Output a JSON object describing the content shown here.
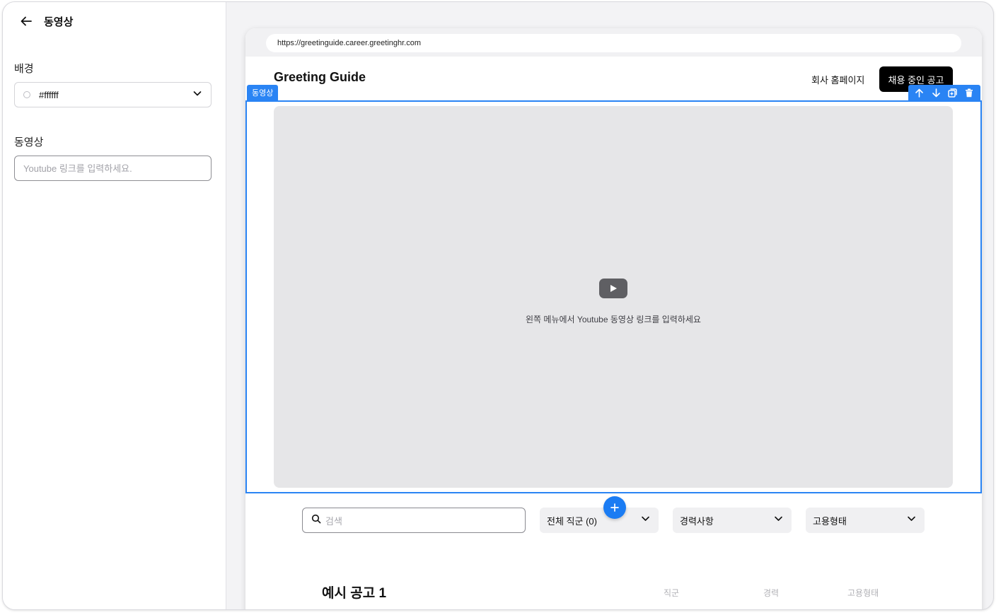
{
  "sidebar": {
    "title": "동영상",
    "background_label": "배경",
    "background_value": "#ffffff",
    "video_label": "동영상",
    "video_input_placeholder": "Youtube 링크를 입력하세요.",
    "video_input_value": ""
  },
  "browser": {
    "url": "https://greetinguide.career.greetinghr.com"
  },
  "site": {
    "logo": "Greeting Guide",
    "nav_home": "회사 홈페이지",
    "nav_jobs": "채용 중인 공고"
  },
  "video_block": {
    "tag": "동영상",
    "hint": "왼쪽 메뉴에서 Youtube 동영상 링크를 입력하세요",
    "toolbar": [
      "arrow-up-icon",
      "arrow-down-icon",
      "duplicate-icon",
      "trash-icon"
    ]
  },
  "filters": {
    "search_placeholder": "검색",
    "job_group": "전체 직군 (0)",
    "experience": "경력사항",
    "employment_type": "고용형태"
  },
  "job_list": {
    "title": "예시 공고 1",
    "columns": [
      "직군",
      "경력",
      "고용형태"
    ]
  },
  "colors": {
    "accent": "#2a84f4",
    "add_button": "#1b7cf3",
    "primary_button": "#000000"
  }
}
